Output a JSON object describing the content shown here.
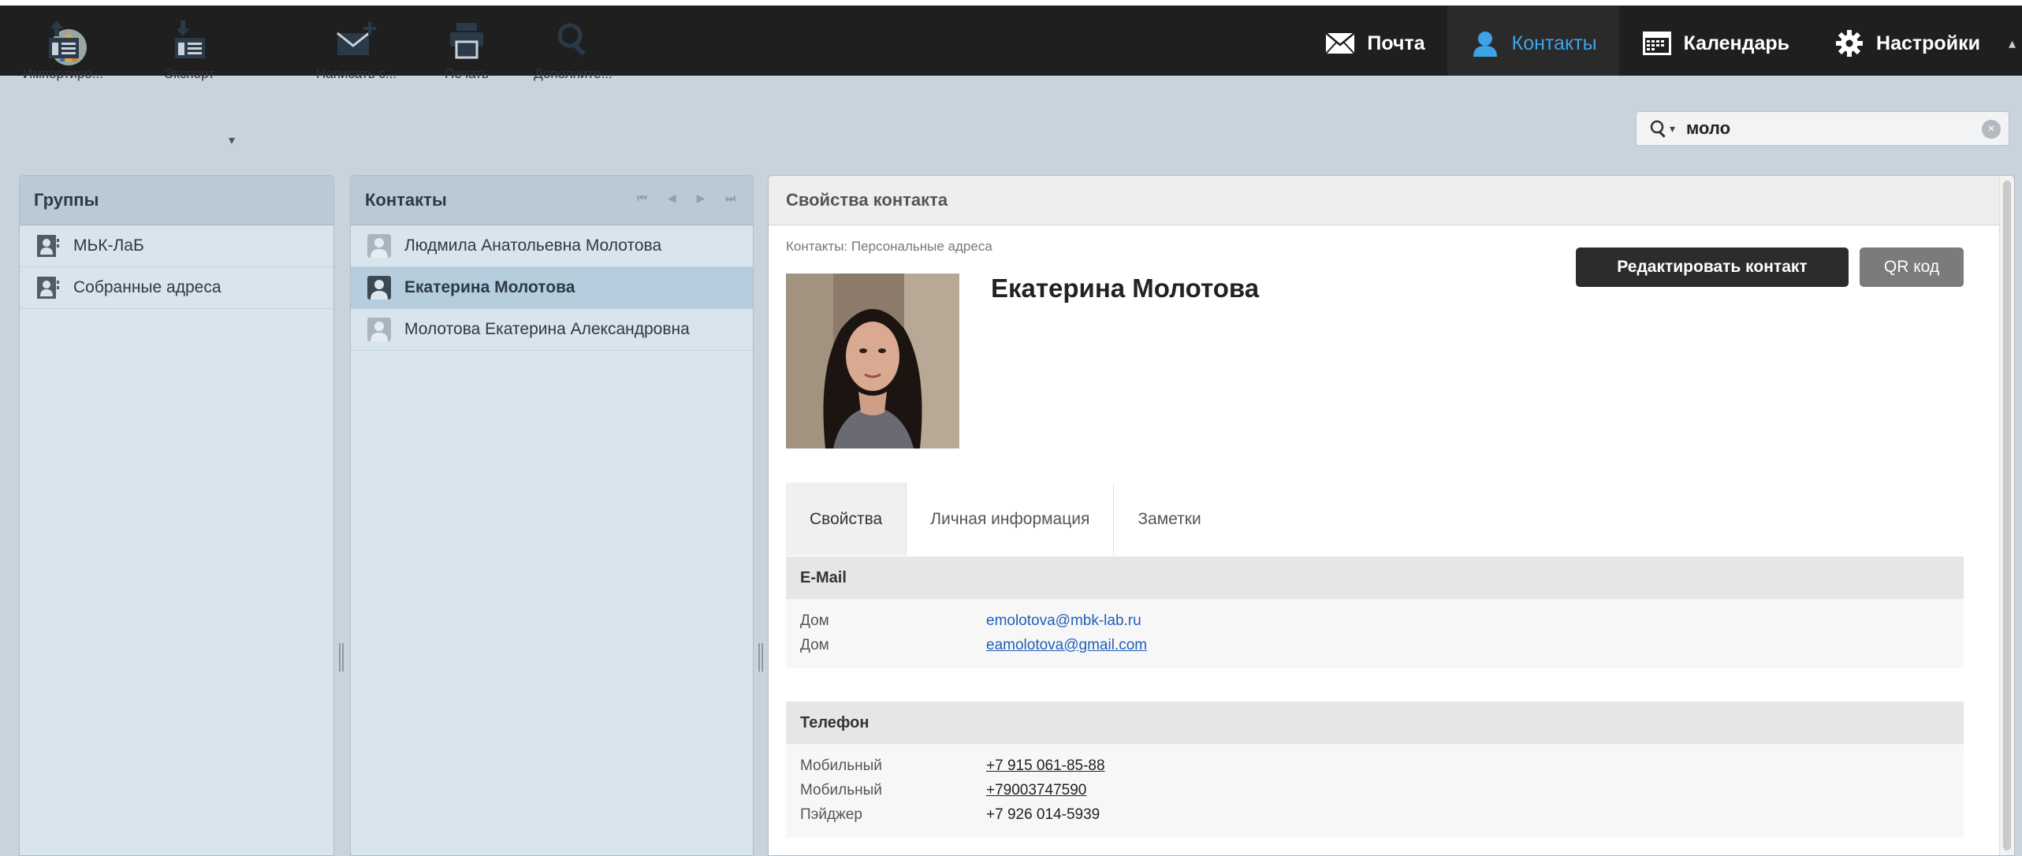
{
  "topnav": {
    "mail": "Почта",
    "contacts": "Контакты",
    "calendar": "Календарь",
    "settings": "Настройки"
  },
  "toolbar": {
    "import": "Импортиро...",
    "export": "Экспорт",
    "compose": "Написать с...",
    "print": "Печать",
    "more": "Дополните..."
  },
  "search": {
    "value": "моло"
  },
  "groups": {
    "title": "Группы",
    "items": [
      {
        "label": "МЬК-ЛаБ"
      },
      {
        "label": "Собранные адреса"
      }
    ]
  },
  "contacts": {
    "title": "Контакты",
    "items": [
      {
        "label": "Людмила Анатольевна Молотова"
      },
      {
        "label": "Екатерина Молотова"
      },
      {
        "label": "Молотова Екатерина Александровна"
      }
    ]
  },
  "details": {
    "title": "Свойства контакта",
    "breadcrumb": "Контакты: Персональные адреса",
    "name": "Екатерина Молотова",
    "edit_button": "Редактировать контакт",
    "qr_button": "QR код",
    "tabs": [
      "Свойства",
      "Личная информация",
      "Заметки"
    ],
    "email": {
      "title": "E-Mail",
      "rows": [
        {
          "label": "Дом",
          "value": "emolotova@mbk-lab.ru"
        },
        {
          "label": "Дом",
          "value": "eamolotova@gmail.com"
        }
      ]
    },
    "phone": {
      "title": "Телефон",
      "rows": [
        {
          "label": "Мобильный",
          "value": "+7 915 061-85-88"
        },
        {
          "label": "Мобильный",
          "value": "+79003747590"
        },
        {
          "label": "Пэйджер",
          "value": "+7 926 014-5939"
        }
      ]
    }
  },
  "colors": {
    "accent": "#3ea3e6",
    "topbar": "#1f1f1f",
    "toolbar": "#c9d3dc",
    "panel": "#d9e5ec"
  }
}
